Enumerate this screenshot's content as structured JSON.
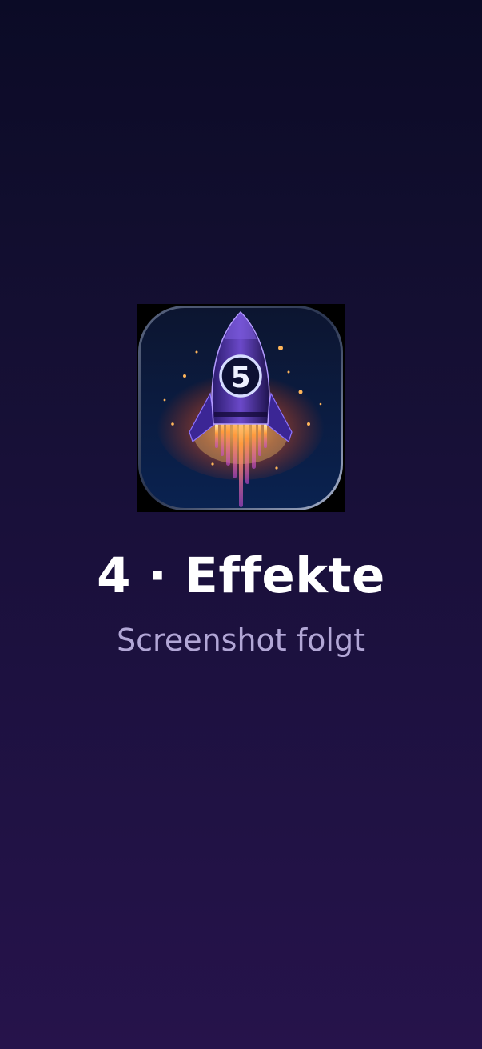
{
  "app_icon": {
    "icon": "rocket-icon",
    "badge_number": "5"
  },
  "title": "4 · Effekte",
  "subtitle": "Screenshot folgt",
  "colors": {
    "background_top": "#0b0b26",
    "background_bottom": "#26134b",
    "title": "#ffffff",
    "subtitle": "#b2a7d6"
  }
}
